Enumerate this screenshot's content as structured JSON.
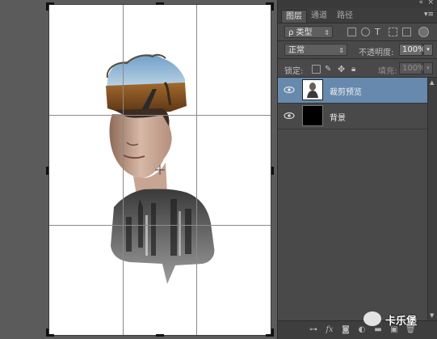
{
  "panel": {
    "tabs": [
      {
        "label": "图层",
        "active": true
      },
      {
        "label": "通道",
        "active": false
      },
      {
        "label": "路径",
        "active": false
      }
    ],
    "filter_kind": "ρ 类型",
    "blend_mode": "正常",
    "opacity_label": "不透明度:",
    "opacity_value": "100%",
    "lock_label": "锁定:",
    "fill_label": "填充:",
    "fill_value": "100%",
    "layers": [
      {
        "name": "裁剪预览",
        "visible": true,
        "selected": true,
        "thumb": "portrait"
      },
      {
        "name": "背景",
        "visible": true,
        "selected": false,
        "thumb": "black"
      }
    ],
    "bottom_icons": [
      "link-icon",
      "fx-icon",
      "mask-icon",
      "adjustment-icon",
      "group-icon",
      "new-layer-icon",
      "trash-icon"
    ]
  },
  "canvas": {
    "grid": "rule-of-thirds",
    "background_color": "#ffffff"
  },
  "watermark": {
    "text": "卡乐堡"
  },
  "colors": {
    "selection": "#6689ad",
    "panel_bg": "#494949",
    "workspace_bg": "#5b5b5b"
  }
}
